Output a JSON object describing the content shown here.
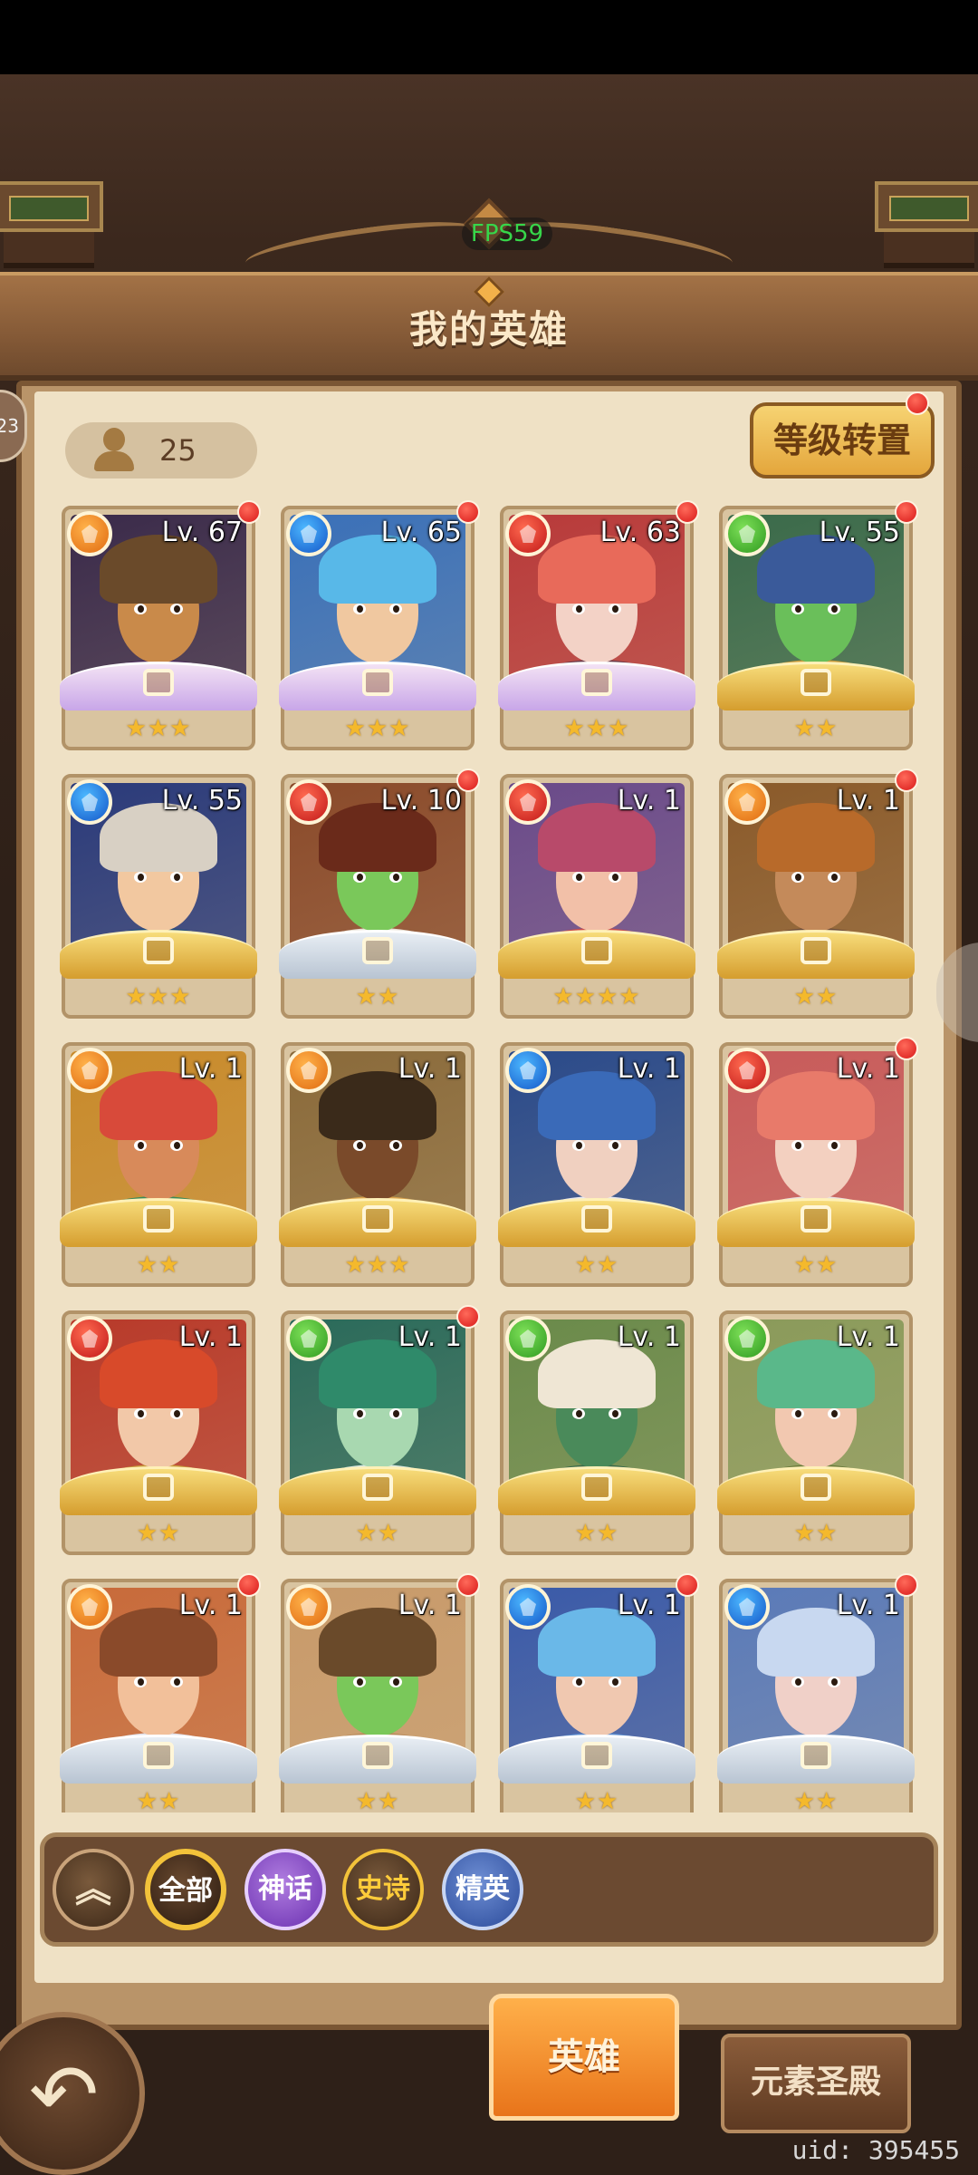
{
  "status": {
    "fps": "FPS59"
  },
  "header": {
    "title": "我的英雄"
  },
  "hero_count": "25",
  "level_transfer_label": "等级转置",
  "heroes": [
    {
      "level": "Lv. 67",
      "element": "earth",
      "stars": "★★★",
      "frame": "myth",
      "dot": true
    },
    {
      "level": "Lv. 65",
      "element": "water",
      "stars": "★★★",
      "frame": "myth",
      "dot": true
    },
    {
      "level": "Lv. 63",
      "element": "fire",
      "stars": "★★★",
      "frame": "myth",
      "dot": true
    },
    {
      "level": "Lv. 55",
      "element": "nature",
      "stars": "★★",
      "frame": "gold",
      "dot": true
    },
    {
      "level": "Lv. 55",
      "element": "water",
      "stars": "★★★",
      "frame": "gold",
      "dot": false
    },
    {
      "level": "Lv. 10",
      "element": "fire",
      "stars": "★★",
      "frame": "silver",
      "dot": true
    },
    {
      "level": "Lv. 1",
      "element": "fire",
      "stars": "★★★★",
      "frame": "gold",
      "dot": false
    },
    {
      "level": "Lv. 1",
      "element": "earth",
      "stars": "★★",
      "frame": "gold",
      "dot": true
    },
    {
      "level": "Lv. 1",
      "element": "earth",
      "stars": "★★",
      "frame": "gold",
      "dot": false
    },
    {
      "level": "Lv. 1",
      "element": "earth",
      "stars": "★★★",
      "frame": "gold",
      "dot": false
    },
    {
      "level": "Lv. 1",
      "element": "water",
      "stars": "★★",
      "frame": "gold",
      "dot": false
    },
    {
      "level": "Lv. 1",
      "element": "fire",
      "stars": "★★",
      "frame": "gold",
      "dot": true
    },
    {
      "level": "Lv. 1",
      "element": "fire",
      "stars": "★★",
      "frame": "gold",
      "dot": false
    },
    {
      "level": "Lv. 1",
      "element": "nature",
      "stars": "★★",
      "frame": "gold",
      "dot": true
    },
    {
      "level": "Lv. 1",
      "element": "nature",
      "stars": "★★",
      "frame": "gold",
      "dot": false
    },
    {
      "level": "Lv. 1",
      "element": "nature",
      "stars": "★★",
      "frame": "gold",
      "dot": false
    },
    {
      "level": "Lv. 1",
      "element": "earth",
      "stars": "★★",
      "frame": "silver",
      "dot": true
    },
    {
      "level": "Lv. 1",
      "element": "earth",
      "stars": "★★",
      "frame": "silver",
      "dot": true
    },
    {
      "level": "Lv. 1",
      "element": "water",
      "stars": "★★",
      "frame": "silver",
      "dot": true
    },
    {
      "level": "Lv. 1",
      "element": "water",
      "stars": "★★",
      "frame": "silver",
      "dot": true
    }
  ],
  "portrait_colors": [
    [
      "#3a2a4a",
      "#c98a4a",
      "#6a4a2a",
      "#4a2a5a"
    ],
    [
      "#3a70b8",
      "#f0c8a0",
      "#58b8e8",
      "#5a8acc"
    ],
    [
      "#b83a3a",
      "#f3d2c6",
      "#e86a5a",
      "#6a3a4a"
    ],
    [
      "#3a6a4a",
      "#6abf5a",
      "#3a5a9a",
      "#c99a3a"
    ],
    [
      "#2a3a7a",
      "#f2c8a0",
      "#d8d0c4",
      "#1e4a7a"
    ],
    [
      "#8a4a2a",
      "#7ac85a",
      "#6a2a1a",
      "#e8e0d4"
    ],
    [
      "#6a4a8a",
      "#f2c0a8",
      "#b84a6a",
      "#c94a4a"
    ],
    [
      "#8a5a2a",
      "#c48a5a",
      "#b86a2a",
      "#6a4a3a"
    ],
    [
      "#c88a2a",
      "#d88a5a",
      "#d84a3a",
      "#3a8a5a"
    ],
    [
      "#8a6a3a",
      "#7a4a2a",
      "#3a2a1a",
      "#d8a04a"
    ],
    [
      "#2a4a8a",
      "#f0d0c0",
      "#3a6ab8",
      "#e8e8f0"
    ],
    [
      "#c85a5a",
      "#f3d0c0",
      "#e87a6a",
      "#e8e0e0"
    ],
    [
      "#b83a2a",
      "#f2c8a8",
      "#d84a2a",
      "#c89a3a"
    ],
    [
      "#2a6a5a",
      "#a8d8b0",
      "#2f8a6a",
      "#d8e8e0"
    ],
    [
      "#6a8a4a",
      "#4a8a5a",
      "#efe6d4",
      "#3a6a4a"
    ],
    [
      "#8a9a5a",
      "#f2c8b0",
      "#5ab88a",
      "#6a7a3a"
    ],
    [
      "#c86a3a",
      "#f2c09a",
      "#8a4a2a",
      "#e0e0e8"
    ],
    [
      "#c89a6a",
      "#7ac85a",
      "#6a4a2a",
      "#b88a5a"
    ],
    [
      "#3a5aa8",
      "#f0c8b0",
      "#6ab8e8",
      "#5a8acc"
    ],
    [
      "#5a7ab8",
      "#f0d0c8",
      "#c8d8f0",
      "#6a8ab8"
    ]
  ],
  "filters": {
    "all": "全部",
    "myth": "神话",
    "epic": "史诗",
    "elite": "精英",
    "collapse_icon": "double-chevron-up"
  },
  "bottom_nav": {
    "hero_tab": "英雄",
    "temple_tab": "元素圣殿",
    "back_icon": "back-arrow"
  },
  "uid": "uid: 395455"
}
